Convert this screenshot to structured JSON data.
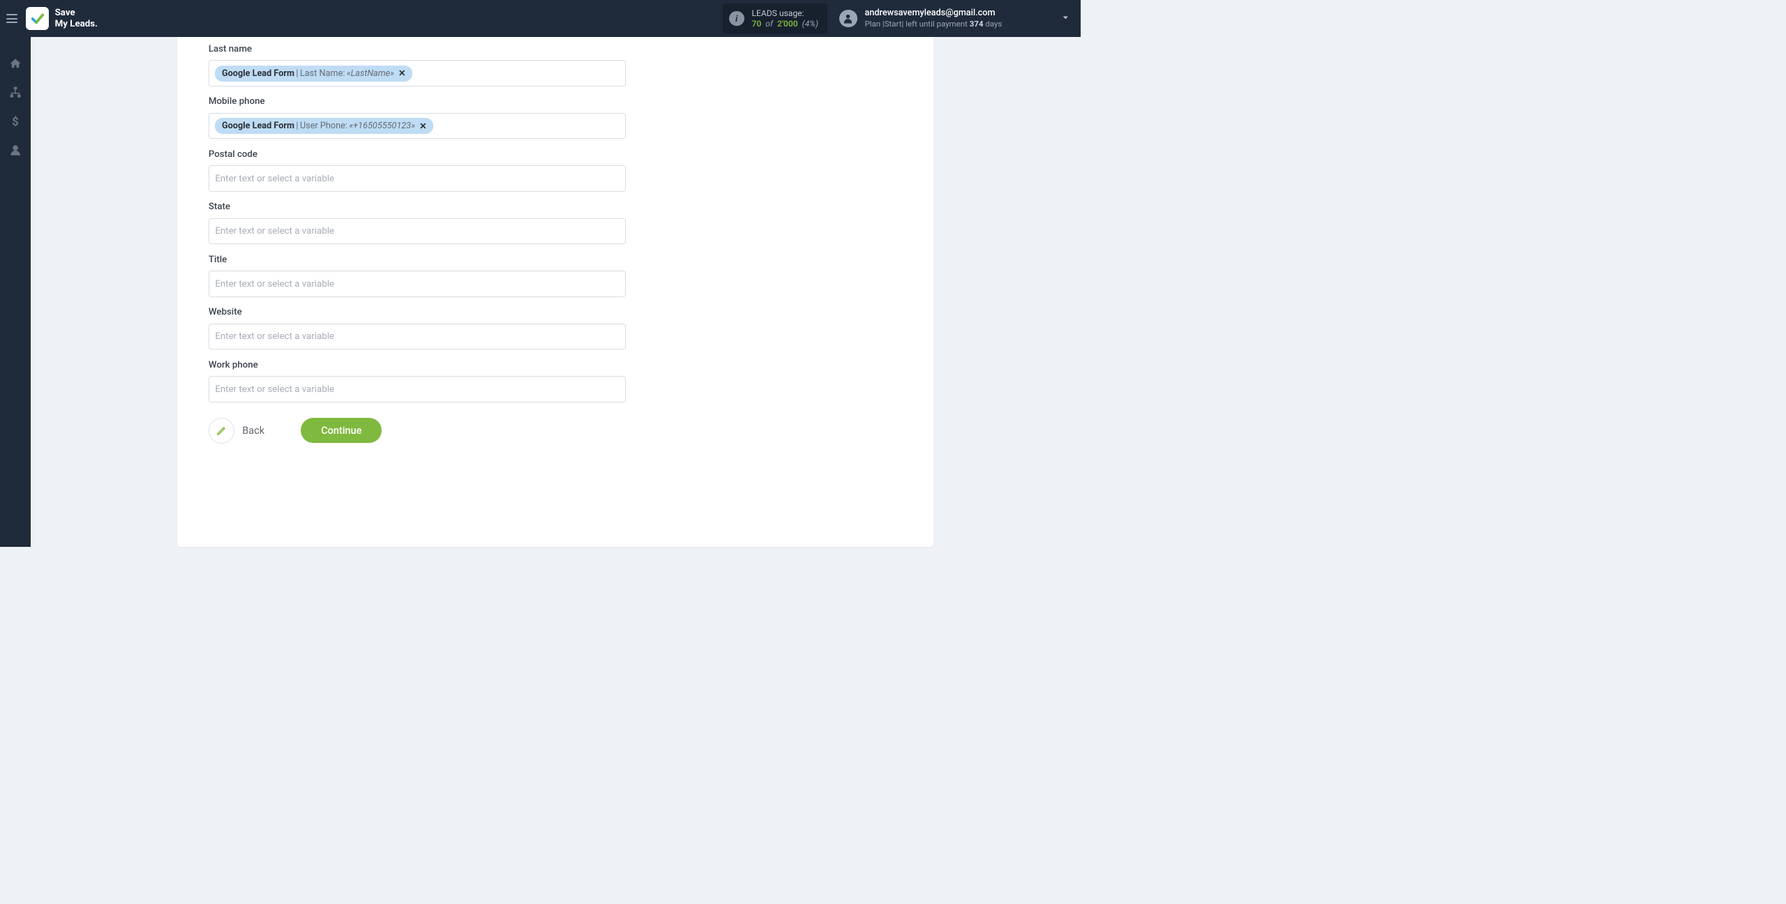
{
  "header": {
    "brand_line1": "Save",
    "brand_line2": "My Leads.",
    "usage": {
      "label": "LEADS usage:",
      "used": "70",
      "of_word": "of",
      "total": "2'000",
      "percent": "(4%)"
    },
    "account": {
      "email": "andrewsavemyleads@gmail.com",
      "plan_prefix": "Plan |",
      "plan_name": "Start",
      "plan_mid": "| left until payment ",
      "days_num": "374",
      "days_word": " days"
    }
  },
  "form": {
    "placeholder": "Enter text or select a variable",
    "fields": {
      "last_name": {
        "label": "Last name",
        "chip_source": "Google Lead Form",
        "chip_sep": " | ",
        "chip_key": "Last Name: ",
        "chip_val": "«LastName»"
      },
      "mobile_phone": {
        "label": "Mobile phone",
        "chip_source": "Google Lead Form",
        "chip_sep": " | ",
        "chip_key": "User Phone: ",
        "chip_val": "«+16505550123»"
      },
      "postal_code": {
        "label": "Postal code"
      },
      "state": {
        "label": "State"
      },
      "title": {
        "label": "Title"
      },
      "website": {
        "label": "Website"
      },
      "work_phone": {
        "label": "Work phone"
      }
    },
    "actions": {
      "back": "Back",
      "continue": "Continue"
    }
  }
}
